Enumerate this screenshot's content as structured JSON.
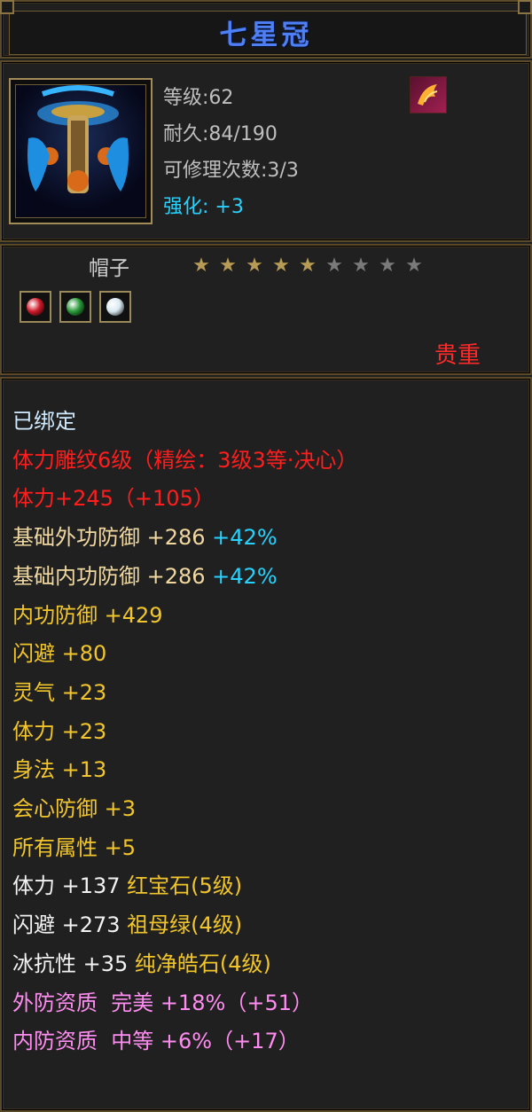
{
  "title": "七星冠",
  "info": {
    "level": "等级:62",
    "durability": "耐久:84/190",
    "repair": "可修理次数:3/3",
    "strengthen_label": "强化:",
    "strengthen_value": "+3"
  },
  "item_type": "帽子",
  "stars": {
    "total": 9,
    "filled": 5
  },
  "rarity": "贵重",
  "gem_slots": [
    {
      "icon": "red-gem-icon",
      "color": "#d01a2a"
    },
    {
      "icon": "green-gem-icon",
      "color": "#2a9a3a"
    },
    {
      "icon": "white-gem-icon",
      "color": "#d8e8f0"
    }
  ],
  "stats": [
    {
      "text": "已绑定",
      "class": "c-cyan"
    },
    {
      "text": "体力雕纹6级（精绘：3级3等·决心）",
      "class": "c-red"
    },
    {
      "text": "体力+245（+105）",
      "class": "c-red"
    },
    {
      "text": "基础外功防御 +286",
      "extra": "+42%",
      "class": "c-beige"
    },
    {
      "text": "基础内功防御 +286",
      "extra": "+42%",
      "class": "c-beige"
    },
    {
      "text": "内功防御 +429",
      "class": "c-yellow"
    },
    {
      "text": "闪避 +80",
      "class": "c-yellow"
    },
    {
      "text": "灵气 +23",
      "class": "c-yellow"
    },
    {
      "text": "体力 +23",
      "class": "c-yellow"
    },
    {
      "text": "身法 +13",
      "class": "c-yellow"
    },
    {
      "text": "会心防御 +3",
      "class": "c-yellow"
    },
    {
      "text": "所有属性 +5",
      "class": "c-yellow"
    },
    {
      "text": "体力 +137",
      "gem": "红宝石(5级)",
      "class": "c-white"
    },
    {
      "text": "闪避 +273",
      "gem": "祖母绿(4级)",
      "class": "c-white"
    },
    {
      "text": "冰抗性 +35",
      "gem": "纯净皓石(4级)",
      "class": "c-white"
    },
    {
      "text": "外防资质  完美 +18%（+51）",
      "class": "c-pink"
    },
    {
      "text": "内防资质  中等 +6%（+17）",
      "class": "c-pink"
    }
  ]
}
